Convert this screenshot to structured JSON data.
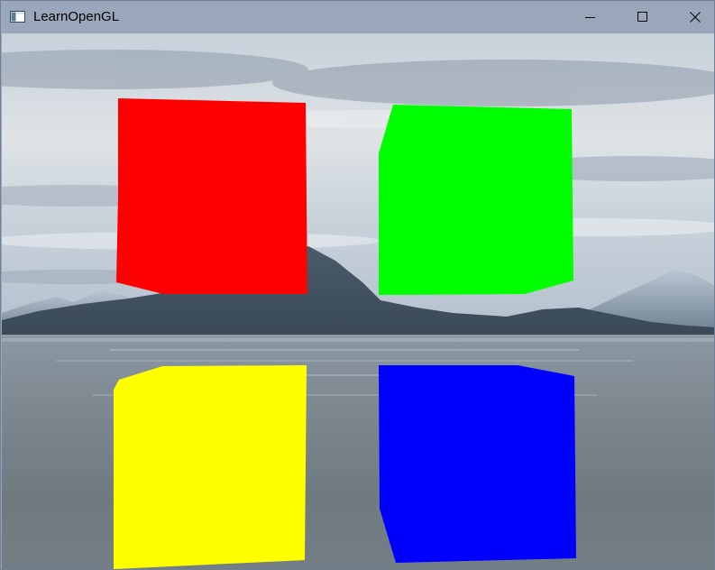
{
  "window": {
    "title": "LearnOpenGL",
    "controls": {
      "minimize_icon": "minimize-icon",
      "maximize_icon": "maximize-icon",
      "close_icon": "close-icon"
    }
  },
  "scene": {
    "skybox": "skybox",
    "cubes": [
      {
        "name": "red",
        "color": "#ff0000"
      },
      {
        "name": "green",
        "color": "#00ff00"
      },
      {
        "name": "yellow",
        "color": "#ffff00"
      },
      {
        "name": "blue",
        "color": "#0000ff"
      }
    ]
  }
}
